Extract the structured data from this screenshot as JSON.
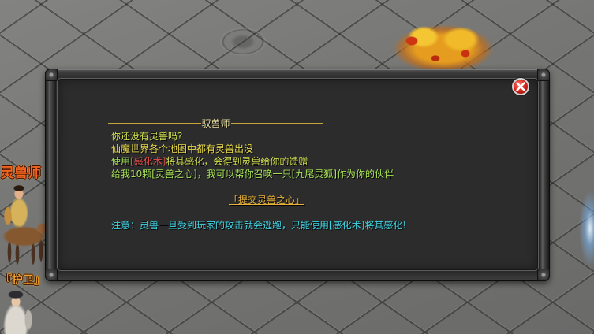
{
  "world": {
    "npc_labels": [
      {
        "text": "灵兽师",
        "color": "#f0641e"
      },
      {
        "text": "『护卫』",
        "color": "#f0a02c"
      }
    ]
  },
  "dialog": {
    "title": "驭兽师",
    "title_color": "#e8dca0",
    "divider_color": "#c9a43c",
    "close_icon": "close-icon",
    "lines": [
      {
        "segments": [
          {
            "text": "你还没有灵兽吗?",
            "color": "#d2e04e"
          }
        ]
      },
      {
        "segments": [
          {
            "text": "仙魔世界各个地图中都有灵兽出没",
            "color": "#e6d84a"
          }
        ]
      },
      {
        "segments": [
          {
            "text": "使用",
            "color": "#9cdc52"
          },
          {
            "text": "[感化术]",
            "color": "#e54b4b"
          },
          {
            "text": "将其感化，会得到灵兽给你的馈赠",
            "color": "#cfdc4c"
          }
        ]
      },
      {
        "segments": [
          {
            "text": "给我10颗[灵兽之心]，我可以帮你召唤一只[九尾灵狐]作为你的伙伴",
            "color": "#a6e056"
          }
        ]
      }
    ],
    "action_link": {
      "text": "「提交灵兽之心」",
      "color": "#e8b23a"
    },
    "note": {
      "text": "注意：灵兽一旦受到玩家的攻击就会逃跑，只能使用[感化术]将其感化!",
      "color": "#3fd4e4"
    }
  }
}
